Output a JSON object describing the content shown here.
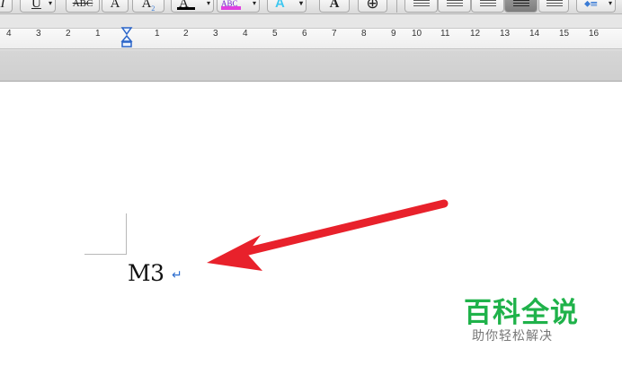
{
  "toolbar": {
    "buttons": [
      {
        "name": "italic-button",
        "label": "I"
      },
      {
        "name": "underline-button",
        "label": "U"
      },
      {
        "name": "strikethrough-button",
        "label": "ABC"
      },
      {
        "name": "superscript-button",
        "label": "A"
      },
      {
        "name": "subscript-button",
        "label": "A"
      },
      {
        "name": "font-color-button",
        "label": "A"
      },
      {
        "name": "highlight-button",
        "label": "ABC"
      },
      {
        "name": "text-effects-button",
        "label": "A"
      },
      {
        "name": "character-shading-button",
        "label": "A"
      },
      {
        "name": "enclose-characters-button",
        "label": "⊕"
      }
    ],
    "subscript_digit": "2",
    "accent_colors": {
      "font_color": "#000000",
      "highlight": "#e040e0",
      "text_effects": "#40c8f0"
    }
  },
  "ruler": {
    "left_numbers": [
      "4",
      "3",
      "2",
      "1"
    ],
    "right_numbers": [
      "1",
      "2",
      "3",
      "4",
      "5",
      "6",
      "7",
      "8",
      "9",
      "10",
      "11",
      "12",
      "13",
      "14",
      "15",
      "16"
    ]
  },
  "document": {
    "text": "M3",
    "paragraph_mark": "↵"
  },
  "annotation": {
    "arrow_color": "#e8212b"
  },
  "watermark": {
    "title": "百科全说",
    "subtitle": "助你轻松解决"
  }
}
